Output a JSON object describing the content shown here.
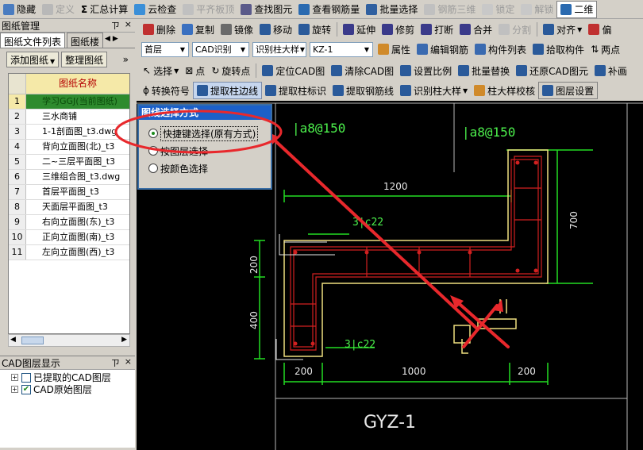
{
  "toolbar1": {
    "items": [
      {
        "label": "隐藏",
        "disabled": false
      },
      {
        "label": "定义",
        "disabled": true
      },
      {
        "label": "汇总计算",
        "disabled": false
      },
      {
        "label": "云检查",
        "disabled": false
      },
      {
        "label": "平齐板顶",
        "disabled": true
      },
      {
        "label": "查找图元",
        "disabled": false
      },
      {
        "label": "查看钢筋量",
        "disabled": false
      },
      {
        "label": "批量选择",
        "disabled": false
      },
      {
        "label": "钢筋三维",
        "disabled": true
      },
      {
        "label": "锁定",
        "disabled": true
      },
      {
        "label": "解锁",
        "disabled": true
      },
      {
        "label": "二维",
        "disabled": false
      }
    ]
  },
  "toolbar2": {
    "items": [
      "删除",
      "复制",
      "镜像",
      "移动",
      "旋转",
      "延伸",
      "修剪",
      "打断",
      "合并",
      "分割",
      "对齐",
      "偏"
    ],
    "disabled_index": 9
  },
  "toolbar3": {
    "combos": [
      "首层",
      "CAD识别",
      "识别柱大样",
      "KZ-1"
    ],
    "items": [
      "属性",
      "编辑钢筋",
      "构件列表",
      "拾取构件",
      "两点"
    ]
  },
  "toolbar4": {
    "items": [
      "选择",
      "点",
      "旋转点",
      "定位CAD图",
      "清除CAD图",
      "设置比例",
      "批量替换",
      "还原CAD图元",
      "补画"
    ]
  },
  "toolbar5": {
    "items": [
      "转换符号",
      "提取柱边线",
      "提取柱标识",
      "提取钢筋线",
      "识别柱大样",
      "柱大样校核",
      "图层设置"
    ]
  },
  "drawings_panel": {
    "title": "图纸管理",
    "pin": "ㄗ",
    "close": "×",
    "tabs": [
      "图纸文件列表",
      "图纸楼"
    ],
    "tab_nav": "◀ ▶",
    "buttons": [
      "添加图纸",
      "整理图纸"
    ],
    "more": "»",
    "column_header": "图纸名称",
    "rows": [
      {
        "num": "1",
        "name": "学习GGJ(当前图纸)"
      },
      {
        "num": "2",
        "name": "三水商铺"
      },
      {
        "num": "3",
        "name": "1-1剖面图_t3.dwg"
      },
      {
        "num": "4",
        "name": "背向立面图(北)_t3"
      },
      {
        "num": "5",
        "name": "二~三层平面图_t3"
      },
      {
        "num": "6",
        "name": "三维组合图_t3.dwg"
      },
      {
        "num": "7",
        "name": "首层平面图_t3"
      },
      {
        "num": "8",
        "name": "天面层平面图_t3"
      },
      {
        "num": "9",
        "name": "右向立面图(东)_t3"
      },
      {
        "num": "10",
        "name": "正向立面图(南)_t3"
      },
      {
        "num": "11",
        "name": "左向立面图(西)_t3"
      }
    ]
  },
  "layer_panel": {
    "title": "CAD图层显示",
    "pin": "ㄗ",
    "close": "×",
    "items": [
      {
        "label": "已提取的CAD图层",
        "checked": false
      },
      {
        "label": "CAD原始图层",
        "checked": true
      }
    ]
  },
  "dialog": {
    "title": "图线选择方式",
    "options": [
      {
        "label": "快捷键选择(原有方式)",
        "selected": true
      },
      {
        "label": "按图层选择",
        "selected": false
      },
      {
        "label": "按颜色选择",
        "selected": false
      }
    ]
  },
  "drawing": {
    "stirrup_labels": [
      "|a8@150",
      "|a8@150"
    ],
    "rebar_labels": [
      "3|c22",
      "3|c22"
    ],
    "dimensions": {
      "top": "1200",
      "right": "700",
      "left_upper": "200",
      "left_lower": "400",
      "bottom_left": "200",
      "bottom_middle": "1000",
      "bottom_right": "200"
    },
    "title": "GYZ-1"
  },
  "colors": {
    "accent_red": "#e8282c",
    "dim_green": "#22dd22",
    "label_green": "#4cf04c",
    "outline_yellow": "#f0e080",
    "rebar_red": "#d22020",
    "dialog_title": "#1c60c8"
  }
}
